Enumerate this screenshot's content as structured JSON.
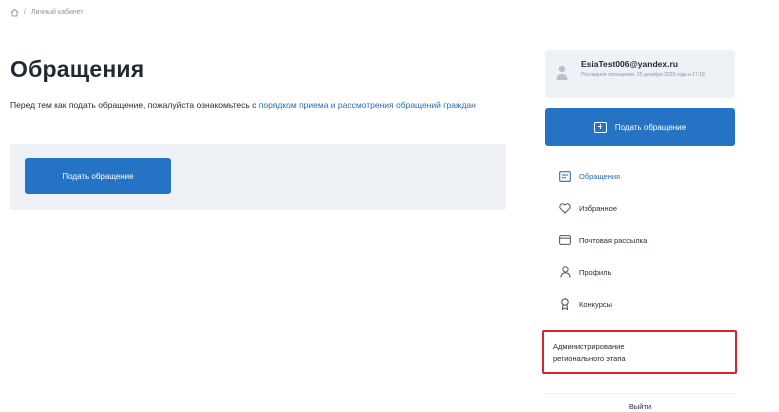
{
  "breadcrumb": {
    "home_icon": "home-icon",
    "separator": "/",
    "current": "Личный кабинет"
  },
  "page": {
    "title": "Обращения",
    "intro_text": "Перед тем как подать обращение, пожалуйста ознакомьтесь с ",
    "intro_link": "порядком приема и рассмотрения обращений граждан",
    "submit_button": "Подать обращение"
  },
  "sidebar": {
    "user": {
      "avatar_icon": "user-avatar-icon",
      "email": "EsiaTest006@yandex.ru",
      "last_login": "Последнее посещение: 25 декабря 2020 года в 17:18"
    },
    "submit_button": "Подать обращение",
    "menu": [
      {
        "label": "Обращения",
        "icon": "document-icon",
        "active": true
      },
      {
        "label": "Избранное",
        "icon": "heart-icon",
        "active": false
      },
      {
        "label": "Почтовая рассылка",
        "icon": "mail-icon",
        "active": false
      },
      {
        "label": "Профиль",
        "icon": "person-icon",
        "active": false
      },
      {
        "label": "Конкурсы",
        "icon": "award-icon",
        "active": false
      }
    ],
    "admin_line1": "Администрирование",
    "admin_line2": "регионального этапа",
    "logout": "Выйти"
  },
  "colors": {
    "accent": "#2473c5",
    "link": "#2a6cb5",
    "panel_bg": "#eef1f6",
    "highlight": "#e02030"
  }
}
